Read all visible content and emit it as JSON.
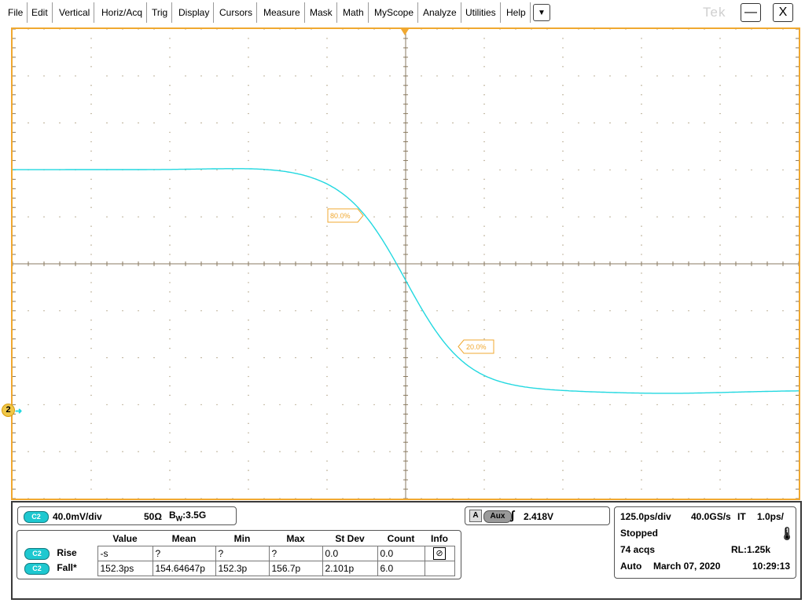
{
  "menu": {
    "items": [
      "File",
      "Edit",
      "Vertical",
      "Horiz/Acq",
      "Trig",
      "Display",
      "Cursors",
      "Measure",
      "Mask",
      "Math",
      "MyScope",
      "Analyze",
      "Utilities",
      "Help"
    ],
    "dropdown": "▼",
    "brand": "Tek",
    "minimize": "—",
    "close": "X"
  },
  "display": {
    "trace_color": "#22d8e0",
    "accent_color": "#f0a830",
    "cursor_high_label": "80.0%",
    "cursor_low_label": "20.0%",
    "channel_marker": "2"
  },
  "channel": {
    "badge": "C2",
    "scale": "40.0mV/div",
    "impedance": "50Ω",
    "bandwidth_prefix": "B",
    "bandwidth_sub": "W",
    "bandwidth": ":3.5G"
  },
  "trigger": {
    "mode_letter": "A",
    "source": "Aux",
    "level": "2.418V"
  },
  "measurements": {
    "headers": [
      "Value",
      "Mean",
      "Min",
      "Max",
      "St Dev",
      "Count",
      "Info"
    ],
    "rows": [
      {
        "badge": "C2",
        "name": "Rise",
        "value": "-s",
        "mean": "?",
        "min": "?",
        "max": "?",
        "stdev": "0.0",
        "count": "0.0"
      },
      {
        "badge": "C2",
        "name": "Fall*",
        "value": "152.3ps",
        "mean": "154.64647p",
        "min": "152.3p",
        "max": "156.7p",
        "stdev": "2.101p",
        "count": "6.0"
      }
    ]
  },
  "acquisition": {
    "timebase": "125.0ps/div",
    "sample_rate": "40.0GS/s",
    "mode": "IT",
    "resolution": "1.0ps/",
    "state": "Stopped",
    "acqs": "74 acqs",
    "record_length": "RL:1.25k",
    "trigger_mode": "Auto",
    "date": "March 07, 2020",
    "time": "10:29:13"
  }
}
